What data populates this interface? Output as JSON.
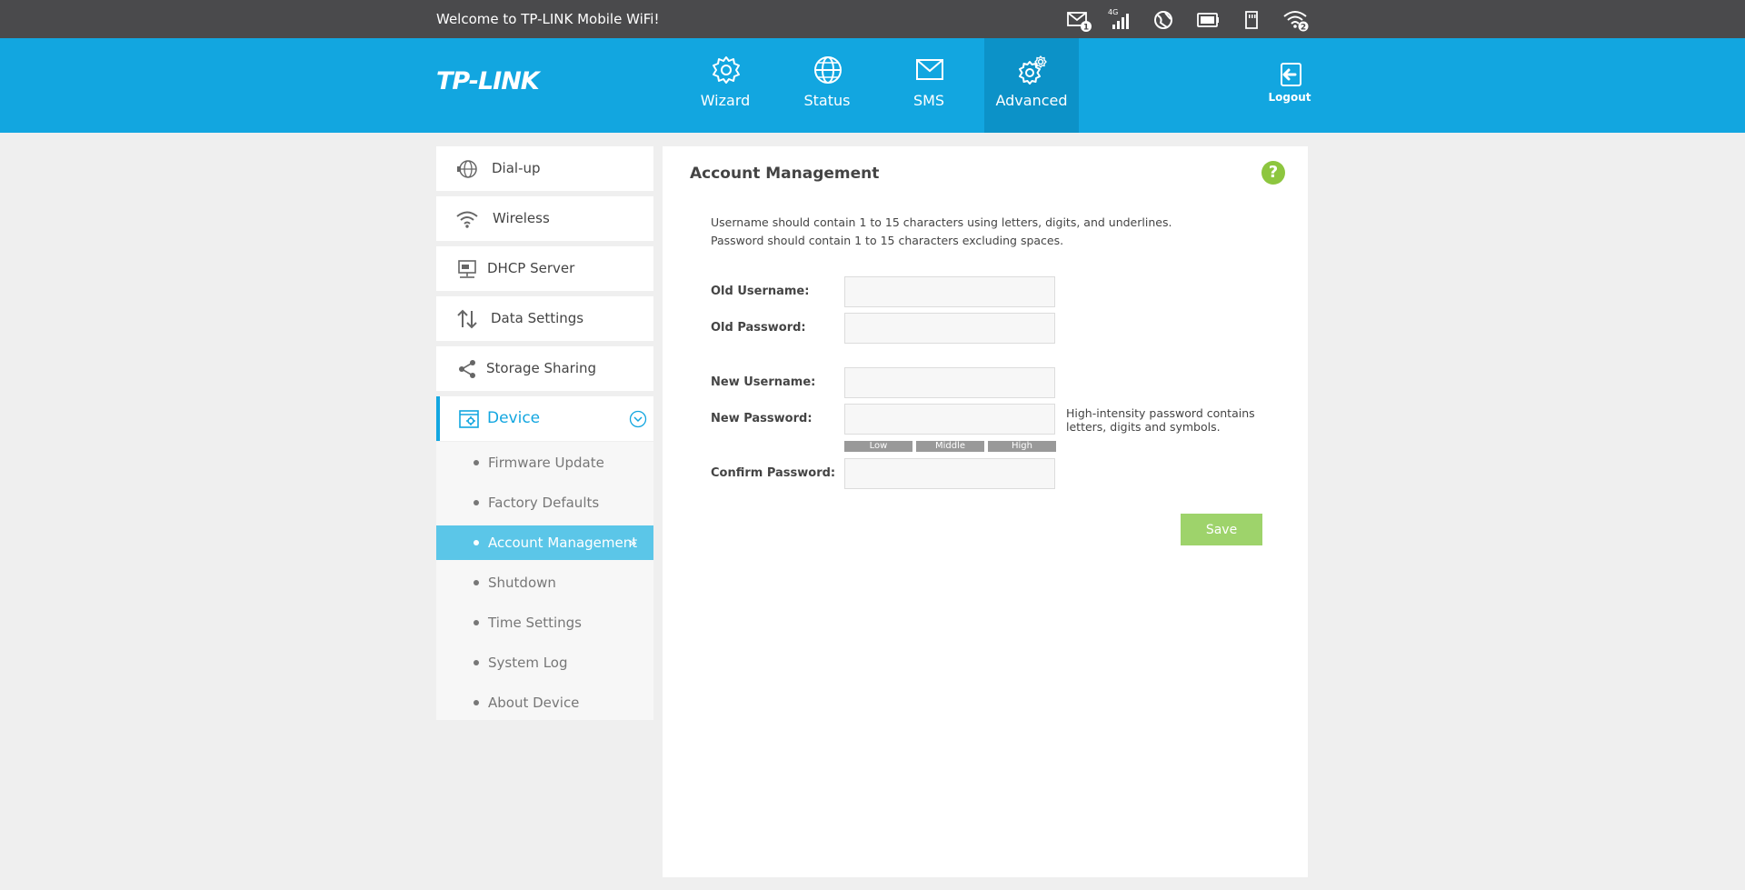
{
  "topbar": {
    "welcome": "Welcome to TP-LINK Mobile WiFi!",
    "sms_badge": "1",
    "network_type": "4G",
    "wifi_clients": "2"
  },
  "header": {
    "logo": "TP-LINK",
    "nav": [
      {
        "label": "Wizard",
        "icon": "gear-icon"
      },
      {
        "label": "Status",
        "icon": "globe-icon"
      },
      {
        "label": "SMS",
        "icon": "envelope-icon"
      },
      {
        "label": "Advanced",
        "icon": "gears-icon",
        "active": true
      }
    ],
    "logout": "Logout"
  },
  "sidebar": {
    "items": [
      {
        "label": "Dial-up",
        "icon": "globe-dial-icon"
      },
      {
        "label": "Wireless",
        "icon": "wifi-icon"
      },
      {
        "label": "DHCP Server",
        "icon": "server-icon"
      },
      {
        "label": "Data Settings",
        "icon": "arrows-updown-icon"
      },
      {
        "label": "Storage Sharing",
        "icon": "share-icon"
      },
      {
        "label": "Device",
        "icon": "device-settings-icon",
        "expanded": true
      }
    ],
    "device_sub": [
      {
        "label": "Firmware Update"
      },
      {
        "label": "Factory Defaults"
      },
      {
        "label": "Account Management",
        "active": true
      },
      {
        "label": "Shutdown"
      },
      {
        "label": "Time Settings"
      },
      {
        "label": "System Log"
      },
      {
        "label": "About Device"
      }
    ]
  },
  "main": {
    "title": "Account Management",
    "help": "?",
    "info_line1": "Username should contain 1 to 15 characters using letters, digits, and underlines.",
    "info_line2": "Password should contain 1 to 15 characters excluding spaces.",
    "fields": {
      "old_username": {
        "label": "Old Username:",
        "value": ""
      },
      "old_password": {
        "label": "Old Password:",
        "value": ""
      },
      "new_username": {
        "label": "New Username:",
        "value": ""
      },
      "new_password": {
        "label": "New Password:",
        "value": ""
      },
      "confirm_password": {
        "label": "Confirm Password:",
        "value": ""
      }
    },
    "hint": "High-intensity password contains letters, digits and symbols.",
    "strength": {
      "low": "Low",
      "middle": "Middle",
      "high": "High"
    },
    "save": "Save"
  },
  "colors": {
    "header": "#12a6e0",
    "topbar": "#4a4a4c",
    "save": "#9ed36b",
    "active_sub": "#5bc6e8",
    "help": "#8dc63f"
  }
}
